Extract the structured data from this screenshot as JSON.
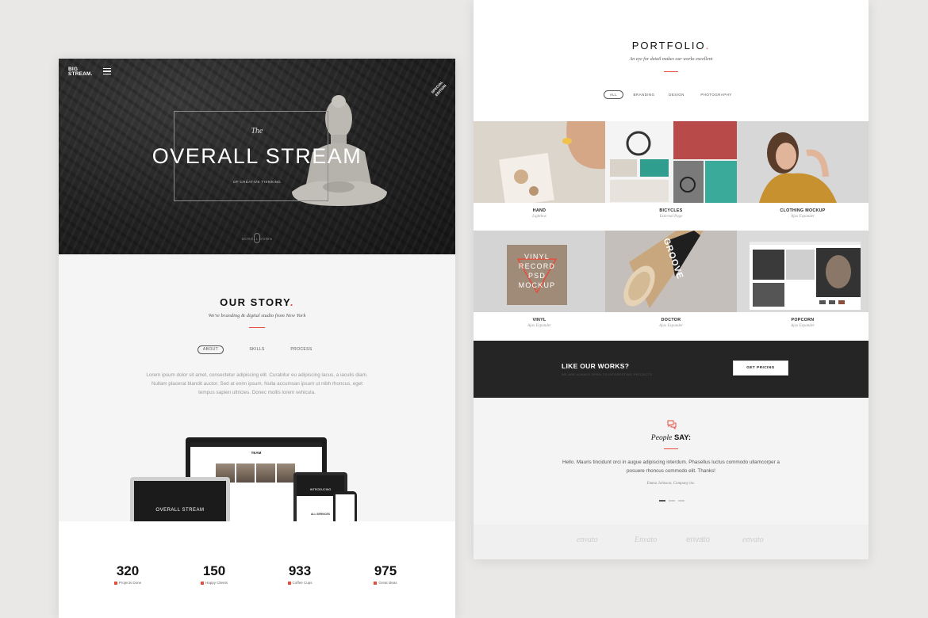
{
  "left_page": {
    "header": {
      "logo_line1": "BIG",
      "logo_line2": "STREAM.",
      "badge_line1": "SPECIAL",
      "badge_line2": "EDITION"
    },
    "hero": {
      "pre_title": "The",
      "title": "OVERALL STREAM",
      "subtitle": "OF CREATIVE THINKING",
      "scroll_label": "SCROLL DOWN"
    },
    "story": {
      "title": "OUR STORY",
      "title_dot": ".",
      "subtitle": "We're branding & digital studio from New York",
      "tabs": [
        "ABOUT",
        "SKILLS",
        "PROCESS"
      ],
      "active_tab": 0,
      "text": "Lorem ipsum dolor sit amet, consectetur adipiscing elit. Curabitur eu adipiscing lacus, a iaculis diam. Nullam placerat blandit auctor. Sed at enim ipsum. Nulla accumsan ipsum ut nibh rhoncus, eget tempus sapien ultricies. Donec mollis lorem vehicula."
    },
    "devices": {
      "monitor_title": "TEAM",
      "laptop_title": "OVERALL STREAM",
      "tablet_title": "INTRODUCING",
      "tablet_services": "ALL SERVICES"
    },
    "stats": [
      {
        "value": "320",
        "label": "Projects Done"
      },
      {
        "value": "150",
        "label": "Happy Clients"
      },
      {
        "value": "933",
        "label": "Coffee Cups"
      },
      {
        "value": "975",
        "label": "Great ideas"
      }
    ]
  },
  "right_page": {
    "portfolio": {
      "title": "PORTFOLIO",
      "title_dot": ".",
      "subtitle": "An eye for detail makes our works excellent",
      "filters": [
        "ALL",
        "BRANDING",
        "DESIGN",
        "PHOTOGRAPHY"
      ],
      "active_filter": 0,
      "items": [
        {
          "title": "HAND",
          "sub": "Lightbox"
        },
        {
          "title": "BICYCLES",
          "sub": "External Page"
        },
        {
          "title": "CLOTHING MOCKUP",
          "sub": "Ajax Expander"
        },
        {
          "title": "VINYL",
          "sub": "Ajax Expander"
        },
        {
          "title": "DOCTOR",
          "sub": "Ajax Expander"
        },
        {
          "title": "POPCORN",
          "sub": "Ajax Expander"
        }
      ],
      "vinyl_art": [
        "VINYL",
        "RECORD",
        "PSD",
        "MOCKUP"
      ],
      "doctor_art": "GROOVE"
    },
    "cta": {
      "title": "LIKE OUR WORKS?",
      "subtitle": "WE ARE ALWAYS OPEN TO INTERESTING PROJECTS",
      "button": "GET PRICING"
    },
    "testimonials": {
      "title_italic": "People",
      "title_bold": "SAY:",
      "quote": "Hello. Mauris tincidunt orci in augue adipiscing interdum. Phasellus luctus commodo ullamcorper a posuere rhoncus commodo elit. Thanks!",
      "author": "Emma Johnson, Company inc."
    },
    "clients": [
      "envato",
      "Envato",
      "envato",
      "envato"
    ]
  },
  "colors": {
    "accent": "#e74c3c",
    "dark": "#252525",
    "page_bg": "#e9e8e6"
  }
}
